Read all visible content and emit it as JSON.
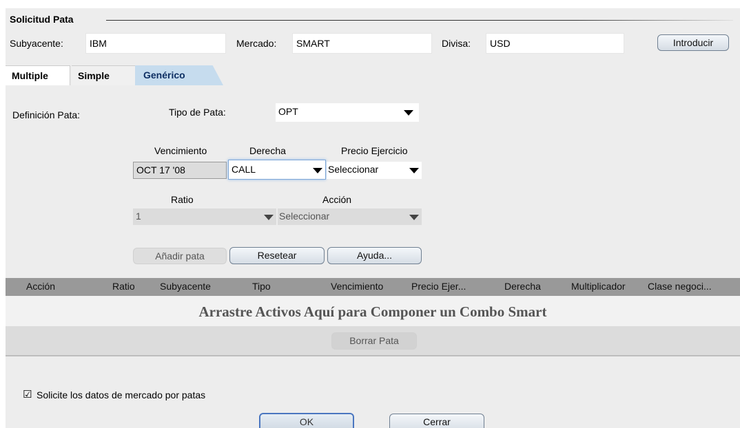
{
  "request": {
    "section_title": "Solicitud Pata",
    "underlying_label": "Subyacente:",
    "underlying_value": "IBM",
    "market_label": "Mercado:",
    "market_value": "SMART",
    "currency_label": "Divisa:",
    "currency_value": "USD",
    "enter_button": "Introducir"
  },
  "tabs": [
    {
      "label": "Multiple",
      "active": false
    },
    {
      "label": "Simple",
      "active": false
    },
    {
      "label": "Genérico",
      "active": true
    }
  ],
  "form": {
    "leg_definition_label": "Definición Pata:",
    "leg_type_label": "Tipo de Pata:",
    "leg_type_value": "OPT",
    "expiry_label": "Vencimiento",
    "expiry_value": "OCT 17 '08",
    "right_label": "Derecha",
    "right_value": "CALL",
    "strike_label": "Precio Ejercicio",
    "strike_value": "Seleccionar",
    "ratio_label": "Ratio",
    "ratio_value": "1",
    "action_label": "Acción",
    "action_value": "Seleccionar",
    "add_leg_button": "Añadir pata",
    "reset_button": "Resetear",
    "help_button": "Ayuda..."
  },
  "table": {
    "columns": [
      "Acción",
      "Ratio",
      "Subyacente",
      "Tipo",
      "Vencimiento",
      "Precio Ejer...",
      "Derecha",
      "Multiplicador",
      "Clase negoci..."
    ],
    "drop_hint": "Arrastre Activos Aquí para Componer un Combo Smart",
    "delete_leg_button": "Borrar Pata"
  },
  "footer": {
    "checkbox_checked": true,
    "checkbox_symbol": "☑",
    "checkbox_label": "Solicite los datos de mercado por patas",
    "ok_button": "OK",
    "close_button": "Cerrar"
  }
}
